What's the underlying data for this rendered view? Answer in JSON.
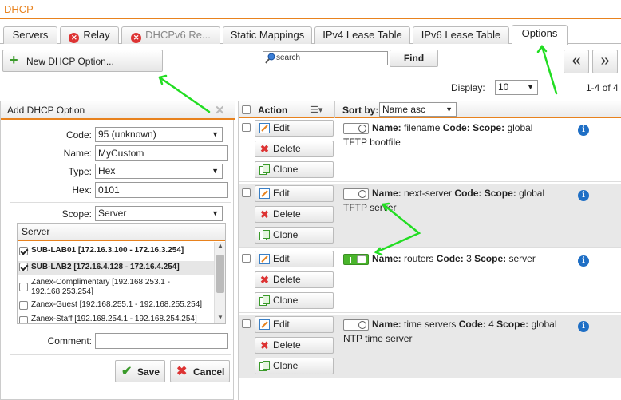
{
  "window": {
    "title": "DHCP"
  },
  "tabs": [
    {
      "label": "Servers"
    },
    {
      "label": "Relay",
      "icon": "error-icon"
    },
    {
      "label": "DHCPv6 Re...",
      "icon": "error-icon"
    },
    {
      "label": "Static Mappings"
    },
    {
      "label": "IPv4 Lease Table"
    },
    {
      "label": "IPv6 Lease Table"
    },
    {
      "label": "Options",
      "active": true
    }
  ],
  "toolbar": {
    "new_label": "New DHCP Option...",
    "search_placeholder": "search",
    "find_label": "Find",
    "prev_label": "«",
    "next_label": "»",
    "display_label": "Display:",
    "display_value": "10",
    "page_range": "1-4 of 4"
  },
  "form": {
    "title": "Add DHCP Option",
    "code_label": "Code:",
    "code_value": "95 (unknown)",
    "name_label": "Name:",
    "name_value": "MyCustom",
    "type_label": "Type:",
    "type_value": "Hex",
    "hex_label": "Hex:",
    "hex_value": "0101",
    "scope_label": "Scope:",
    "scope_value": "Server",
    "server_header": "Server",
    "servers": [
      {
        "label": "SUB-LAB01 [172.16.3.100 - 172.16.3.254]",
        "checked": true,
        "bold": true
      },
      {
        "label": "SUB-LAB2 [172.16.4.128 - 172.16.4.254]",
        "checked": true,
        "bold": true
      },
      {
        "label": "Zanex-Complimentary [192.168.253.1 - 192.168.253.254]",
        "checked": false
      },
      {
        "label": "Zanex-Guest [192.168.255.1 - 192.168.255.254]",
        "checked": false
      },
      {
        "label": "Zanex-Staff [192.168.254.1 - 192.168.254.254]",
        "checked": false
      }
    ],
    "comment_label": "Comment:",
    "comment_value": "",
    "save_label": "Save",
    "cancel_label": "Cancel"
  },
  "grid": {
    "action_header": "Action",
    "sortby_label": "Sort by:",
    "sortby_value": "Name asc",
    "edit_label": "Edit",
    "delete_label": "Delete",
    "clone_label": "Clone",
    "rows": [
      {
        "name_key": "Name:",
        "name": "filename",
        "code_key": "Code:",
        "code": "",
        "scope_key": "Scope:",
        "scope": "global",
        "desc": "TFTP bootfile",
        "enabled": false
      },
      {
        "name_key": "Name:",
        "name": "next-server",
        "code_key": "Code:",
        "code": "",
        "scope_key": "Scope:",
        "scope": "global",
        "desc": "TFTP server",
        "enabled": false
      },
      {
        "name_key": "Name:",
        "name": "routers",
        "code_key": "Code:",
        "code": "3",
        "scope_key": "Scope:",
        "scope": "server",
        "desc": "",
        "enabled": true
      },
      {
        "name_key": "Name:",
        "name": "time servers",
        "code_key": "Code:",
        "code": "4",
        "scope_key": "Scope:",
        "scope": "global",
        "desc": "NTP time server",
        "enabled": false
      }
    ]
  },
  "colors": {
    "accent": "#e8821e",
    "annotation_arrow": "#22dd22",
    "error": "#d33333",
    "info": "#1f6fc5",
    "toggle_on": "#4ab52c"
  }
}
